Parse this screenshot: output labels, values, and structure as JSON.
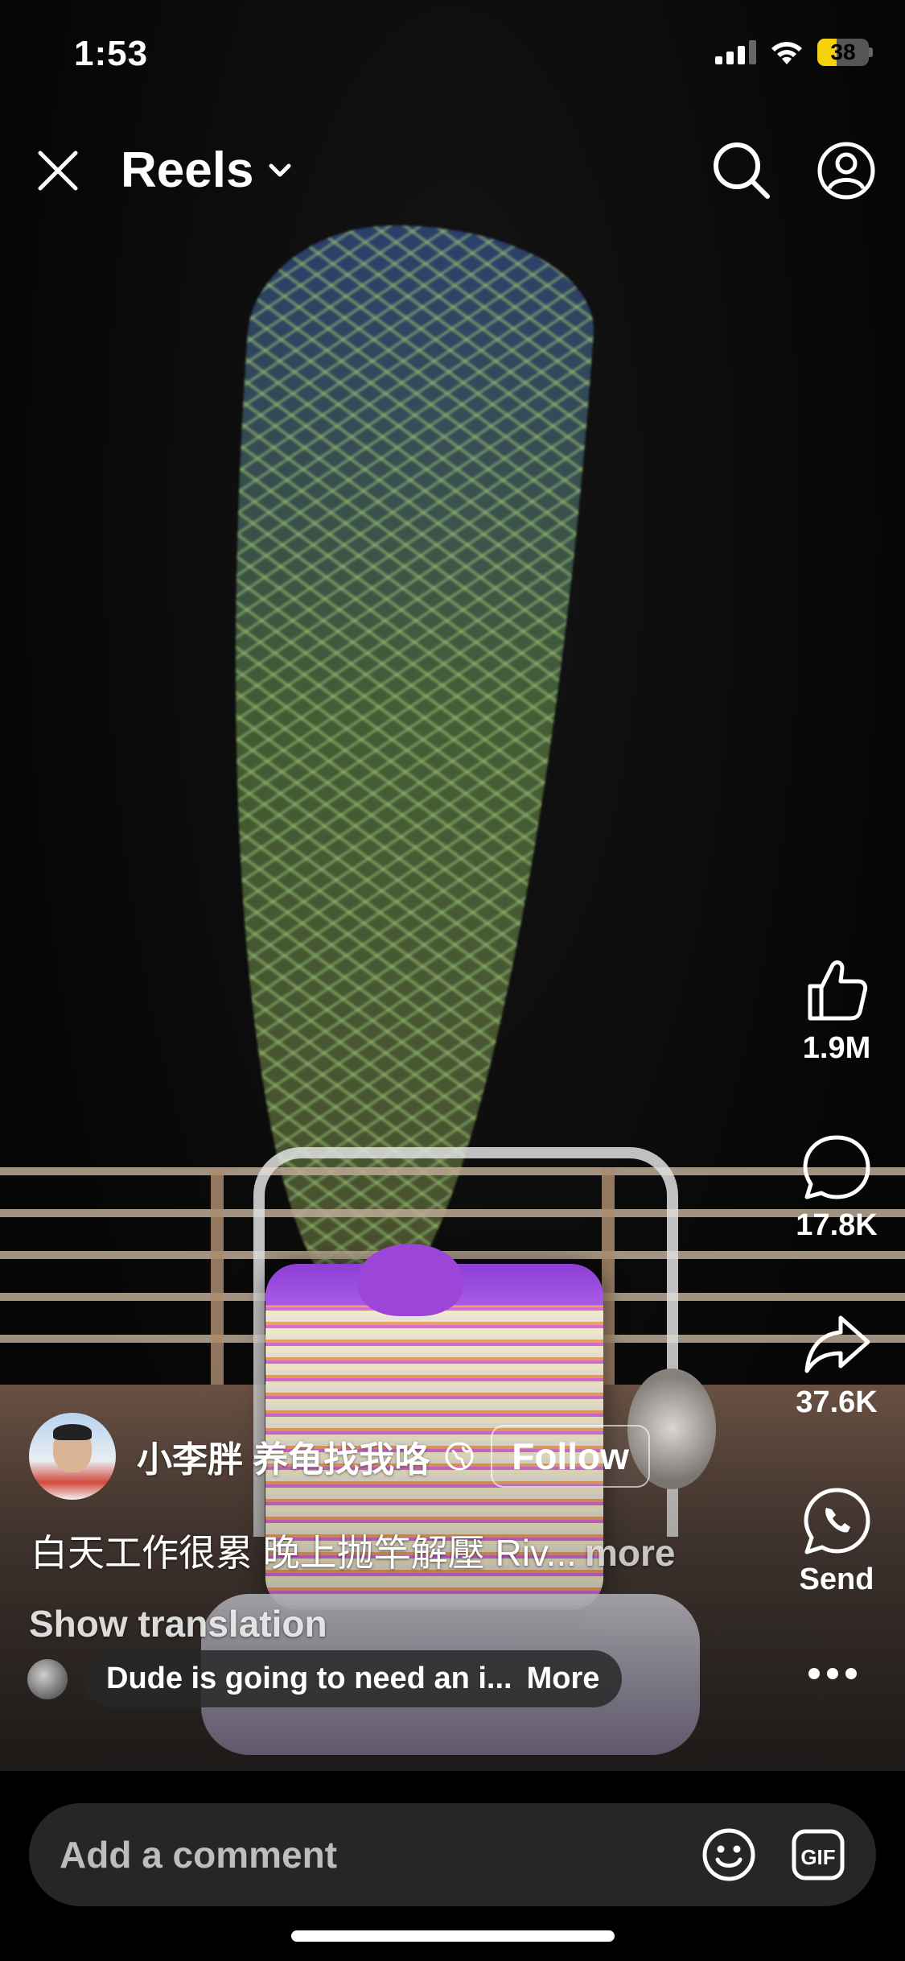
{
  "status_bar": {
    "time": "1:53",
    "battery": "38",
    "battery_fraction": 0.38,
    "battery_color": "#f5d10b"
  },
  "header": {
    "title": "Reels",
    "icons": {
      "close": "close-icon",
      "dropdown": "chevron-down-icon",
      "search": "search-icon",
      "profile": "profile-icon"
    }
  },
  "actions": {
    "like_count": "1.9M",
    "comment_count": "17.8K",
    "share_count": "37.6K",
    "send_label": "Send",
    "icons": [
      "thumbs-up-icon",
      "comment-icon",
      "share-icon",
      "whatsapp-icon",
      "more-icon"
    ]
  },
  "post": {
    "username": "小李胖 养龟找我咯",
    "follow_label": "Follow",
    "caption": "白天工作很累 晚上抛竿解壓 Riv...",
    "caption_more": "more",
    "show_translation": "Show translation",
    "top_comment": "Dude is going to need an i...",
    "top_comment_more": "More"
  },
  "comment_bar": {
    "placeholder": "Add a comment",
    "icons": [
      "emoji-icon",
      "gif-icon"
    ]
  }
}
